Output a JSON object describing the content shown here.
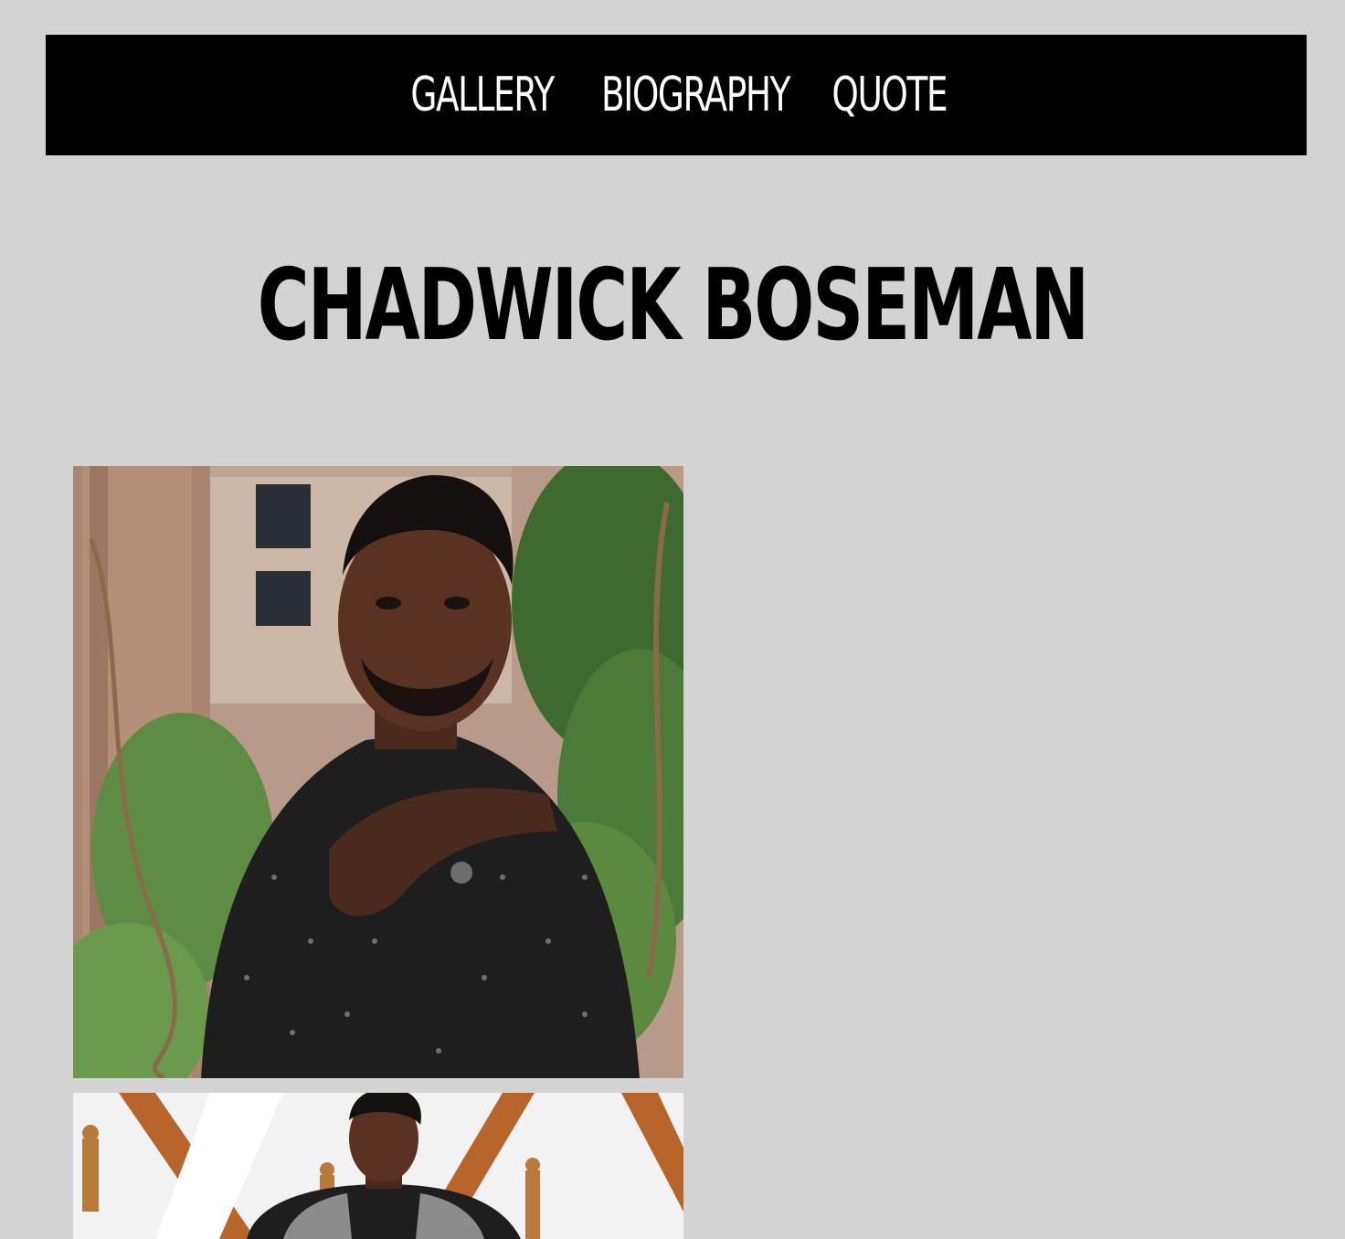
{
  "nav": {
    "items": [
      {
        "label": "GALLERY"
      },
      {
        "label": "BIOGRAPHY"
      },
      {
        "label": "QUOTE"
      }
    ]
  },
  "page": {
    "title": "CHADWICK BOSEMAN"
  },
  "gallery": {
    "images": [
      {
        "name": "portrait-patterned-shirt"
      },
      {
        "name": "red-carpet-oscars"
      }
    ]
  },
  "colors": {
    "background": "#d3d3d3",
    "navbar": "#000000",
    "nav_text": "#ffffff",
    "title_text": "#000000"
  }
}
